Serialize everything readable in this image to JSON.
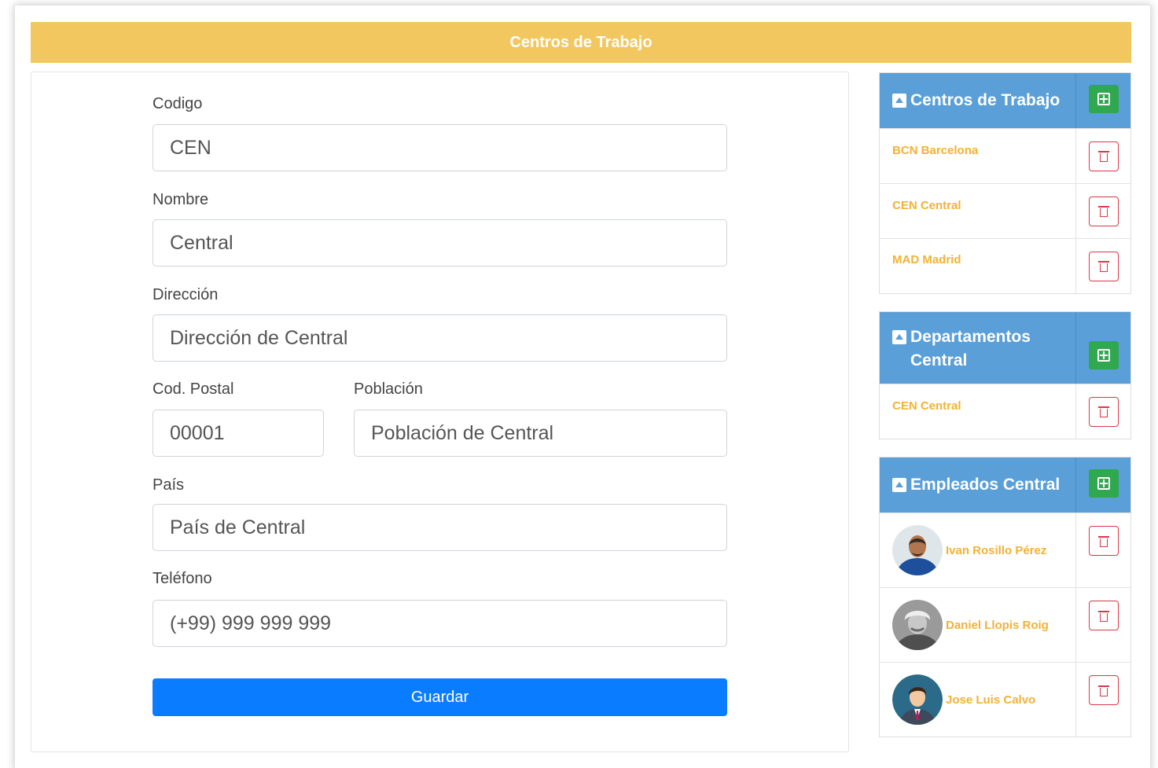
{
  "header": {
    "title": "Centros de Trabajo"
  },
  "form": {
    "codigo": {
      "label": "Codigo",
      "value": "CEN"
    },
    "nombre": {
      "label": "Nombre",
      "value": "Central"
    },
    "direccion": {
      "label": "Dirección",
      "value": "Dirección de Central"
    },
    "cod_postal": {
      "label": "Cod. Postal",
      "value": "00001"
    },
    "poblacion": {
      "label": "Población",
      "value": "Población de Central"
    },
    "pais": {
      "label": "País",
      "value": "País de Central"
    },
    "telefono": {
      "label": "Teléfono",
      "value": "(+99) 999 999 999"
    },
    "save_label": "Guardar"
  },
  "centros_panel": {
    "title": "Centros de Trabajo",
    "items": [
      {
        "label": "BCN Barcelona"
      },
      {
        "label": "CEN Central"
      },
      {
        "label": "MAD Madrid"
      }
    ]
  },
  "departamentos_panel": {
    "title": "Departamentos Central",
    "items": [
      {
        "label": "CEN Central"
      }
    ]
  },
  "empleados_panel": {
    "title": "Empleados Central",
    "items": [
      {
        "label": "Ivan Rosillo Pérez",
        "avatar": "avatar-photo"
      },
      {
        "label": "Daniel Llopis Roig",
        "avatar": "avatar-photo"
      },
      {
        "label": "Jose Luis Calvo",
        "avatar": "avatar-illustration"
      }
    ]
  },
  "colors": {
    "topbar": "#f2c75f",
    "panel_header": "#5a9fd8",
    "add_button": "#2fa84f",
    "delete_button": "#dc3545",
    "link_text": "#f2b233",
    "save_button": "#0a7cff"
  }
}
